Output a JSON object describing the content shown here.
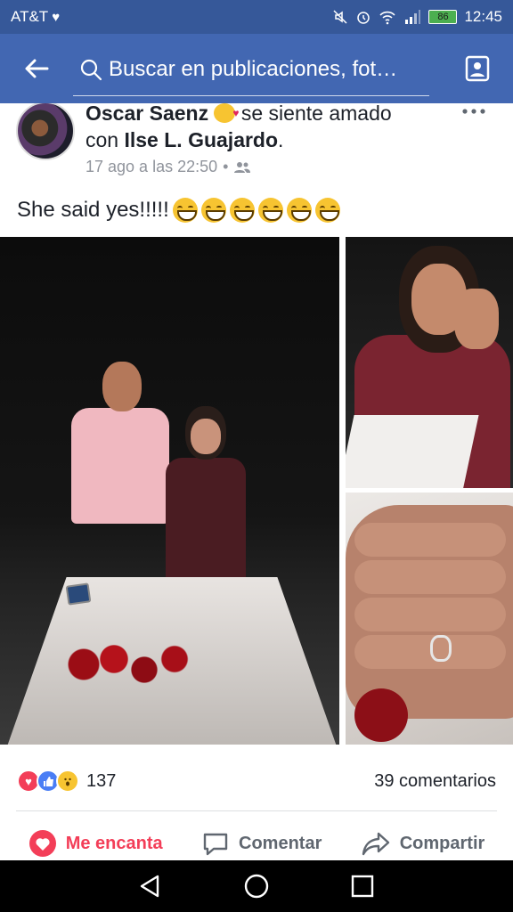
{
  "status_bar": {
    "carrier": "AT&T",
    "battery": "86",
    "time": "12:45"
  },
  "app_bar": {
    "search_text": "Buscar en publicaciones, fot…"
  },
  "post": {
    "author": "Oscar Saenz",
    "feeling_text": "se siente amado",
    "with_prefix": "con",
    "tagged": "Ilse L. Guajardo",
    "tagged_suffix": ".",
    "timestamp": "17 ago a las 22:50",
    "separator": "•",
    "text": "She said yes!!!!!",
    "reaction_count": "137",
    "comments_count": "39 comentarios",
    "actions": {
      "love": "Me encanta",
      "comment": "Comentar",
      "share": "Compartir"
    }
  },
  "colors": {
    "status_bar_bg": "#365899",
    "app_bar_bg": "#4267b2",
    "love_red": "#f33e58",
    "like_blue": "#4a7ef5"
  },
  "icons": {
    "back": "arrow-left-icon",
    "search": "search-icon",
    "profile": "photo-profile-icon",
    "audience": "friends-icon",
    "more": "more-icon"
  }
}
